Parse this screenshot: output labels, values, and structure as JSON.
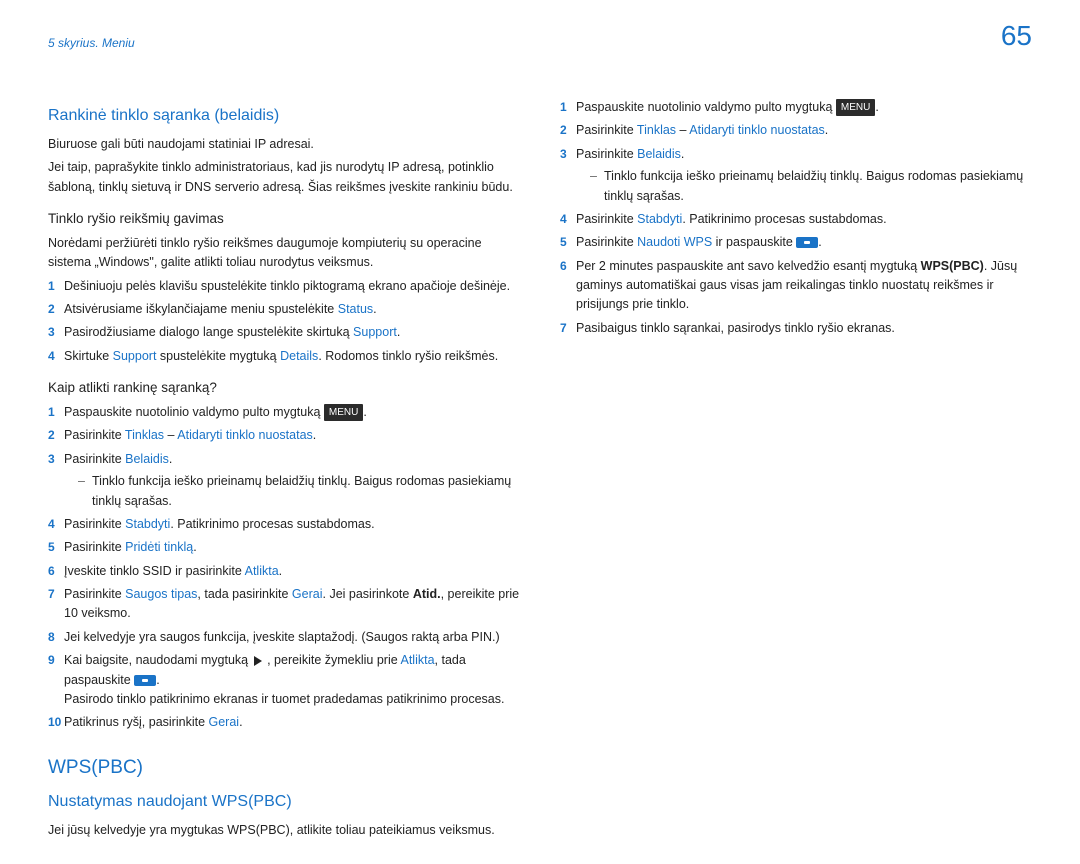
{
  "header": {
    "chapter": "5 skyrius. Meniu",
    "page_number": "65"
  },
  "left": {
    "title1": "Rankinė tinklo sąranka (belaidis)",
    "p1": "Biuruose gali būti naudojami statiniai IP adresai.",
    "p2": "Jei taip, paprašykite tinklo administratoriaus, kad jis nurodytų IP adresą, potinklio šabloną, tinklų sietuvą ir DNS serverio adresą. Šias reikšmes įveskite rankiniu būdu.",
    "sub1": "Tinklo ryšio reikšmių gavimas",
    "p3": "Norėdami peržiūrėti tinklo ryšio reikšmes daugumoje kompiuterių su operacine sistema „Windows\", galite atlikti toliau nurodytus veiksmus.",
    "list1": {
      "i1": "Dešiniuoju pelės klavišu spustelėkite tinklo piktogramą ekrano apačioje dešinėje.",
      "i2a": "Atsivėrusiame iškylančiajame meniu spustelėkite ",
      "i2b": "Status",
      "i2c": ".",
      "i3a": "Pasirodžiusiame dialogo lange spustelėkite skirtuką ",
      "i3b": "Support",
      "i3c": ".",
      "i4a": "Skirtuke ",
      "i4b": "Support",
      "i4c": " spustelėkite mygtuką ",
      "i4d": "Details",
      "i4e": ". Rodomos tinklo ryšio reikšmės."
    },
    "sub2": "Kaip atlikti rankinę sąranką?",
    "list2": {
      "i1a": "Paspauskite nuotolinio valdymo pulto mygtuką ",
      "i1b": "MENU",
      "i1c": ".",
      "i2a": "Pasirinkite ",
      "i2b": "Tinklas",
      "i2c": " – ",
      "i2d": "Atidaryti tinklo nuostatas",
      "i2e": ".",
      "i3a": "Pasirinkite ",
      "i3b": "Belaidis",
      "i3c": ".",
      "i3sub": "Tinklo funkcija ieško prieinamų belaidžių tinklų. Baigus rodomas pasiekiamų tinklų sąrašas.",
      "i4a": "Pasirinkite ",
      "i4b": "Stabdyti",
      "i4c": ". Patikrinimo procesas sustabdomas.",
      "i5a": "Pasirinkite ",
      "i5b": "Pridėti tinklą",
      "i5c": ".",
      "i6a": "Įveskite tinklo SSID ir pasirinkite ",
      "i6b": "Atlikta",
      "i6c": ".",
      "i7a": "Pasirinkite ",
      "i7b": "Saugos tipas",
      "i7c": ", tada pasirinkite ",
      "i7d": "Gerai",
      "i7e": ". Jei pasirinkote ",
      "i7f": "Atid.",
      "i7g": ", pereikite prie 10 veiksmo.",
      "i8": "Jei kelvedyje yra saugos funkcija, įveskite slaptažodį. (Saugos raktą arba PIN.)",
      "i9a": "Kai baigsite, naudodami mygtuką ",
      "i9b": " , pereikite žymekliu prie ",
      "i9c": "Atlikta",
      "i9d": ", tada paspauskite ",
      "i9e": ".",
      "i9f": "Pasirodo tinklo patikrinimo ekranas ir tuomet pradedamas patikrinimo procesas.",
      "i10a": "Patikrinus ryšį, pasirinkite ",
      "i10b": "Gerai",
      "i10c": "."
    },
    "title2": "WPS(PBC)",
    "sub3": "Nustatymas naudojant WPS(PBC)",
    "p4": "Jei jūsų kelvedyje yra mygtukas WPS(PBC), atlikite toliau pateikiamus veiksmus."
  },
  "right": {
    "list": {
      "i1a": "Paspauskite nuotolinio valdymo pulto mygtuką ",
      "i1b": "MENU",
      "i1c": ".",
      "i2a": "Pasirinkite ",
      "i2b": "Tinklas",
      "i2c": " – ",
      "i2d": "Atidaryti tinklo nuostatas",
      "i2e": ".",
      "i3a": "Pasirinkite ",
      "i3b": "Belaidis",
      "i3c": ".",
      "i3sub": "Tinklo funkcija ieško prieinamų belaidžių tinklų. Baigus rodomas pasiekiamų tinklų sąrašas.",
      "i4a": "Pasirinkite ",
      "i4b": "Stabdyti",
      "i4c": ". Patikrinimo procesas sustabdomas.",
      "i5a": "Pasirinkite ",
      "i5b": "Naudoti WPS",
      "i5c": " ir paspauskite ",
      "i5d": ".",
      "i6a": "Per 2 minutes paspauskite ant savo kelvedžio esantį mygtuką ",
      "i6b": "WPS(PBC)",
      "i6c": ". Jūsų gaminys automatiškai gaus visas jam reikalingas tinklo nuostatų reikšmes ir prisijungs prie tinklo.",
      "i7": "Pasibaigus tinklo sąrankai, pasirodys tinklo ryšio ekranas."
    }
  }
}
